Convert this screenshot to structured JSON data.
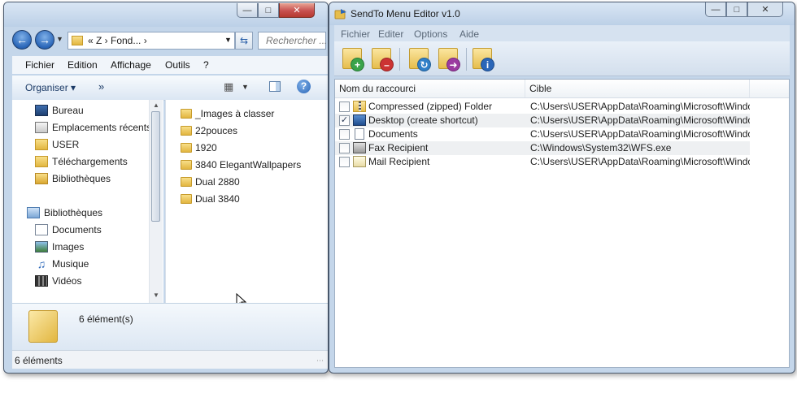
{
  "explorer": {
    "address": "« Z › Fond... ›",
    "search_placeholder": "Rechercher ...",
    "menu": [
      "Fichier",
      "Edition",
      "Affichage",
      "Outils",
      "?"
    ],
    "organize_label": "Organiser ▾",
    "more_label": "»",
    "nav": {
      "favorites": [
        "Bureau",
        "Emplacements récents",
        "USER",
        "Téléchargements",
        "Bibliothèques"
      ],
      "libraries_label": "Bibliothèques",
      "libraries": [
        "Documents",
        "Images",
        "Musique",
        "Vidéos"
      ]
    },
    "files": [
      "_Images à classer",
      "22pouces",
      "1920",
      "3840 ElegantWallpapers",
      "Dual 2880",
      "Dual 3840"
    ],
    "details_count": "6 élément(s)",
    "status_text": "6 éléments"
  },
  "sendto": {
    "title": "SendTo Menu Editor v1.0",
    "menu": [
      "Fichier",
      "Editer",
      "Options",
      "Aide"
    ],
    "columns": [
      "Nom du raccourci",
      "Cible"
    ],
    "rows": [
      {
        "name": "Compressed (zipped) Folder",
        "target": "C:\\Users\\USER\\AppData\\Roaming\\Microsoft\\Windo...",
        "checked": false,
        "icon": "zip-folder-icon"
      },
      {
        "name": "Desktop (create shortcut)",
        "target": "C:\\Users\\USER\\AppData\\Roaming\\Microsoft\\Windo...",
        "checked": true,
        "icon": "desktop-icon"
      },
      {
        "name": "Documents",
        "target": "C:\\Users\\USER\\AppData\\Roaming\\Microsoft\\Windo...",
        "checked": false,
        "icon": "document-icon"
      },
      {
        "name": "Fax Recipient",
        "target": "C:\\Windows\\System32\\WFS.exe",
        "checked": false,
        "icon": "fax-icon"
      },
      {
        "name": "Mail Recipient",
        "target": "C:\\Users\\USER\\AppData\\Roaming\\Microsoft\\Windo...",
        "checked": false,
        "icon": "mail-icon"
      }
    ],
    "toolbar_icons": [
      "add-folder-icon",
      "remove-folder-icon",
      "refresh-folder-icon",
      "move-folder-icon",
      "info-folder-icon"
    ]
  },
  "colors": {
    "title_gradient_top": "#d9e6f4",
    "accent_blue": "#2a66b8",
    "close_red": "#c75050",
    "folder_yellow": "#e6bd4c"
  }
}
